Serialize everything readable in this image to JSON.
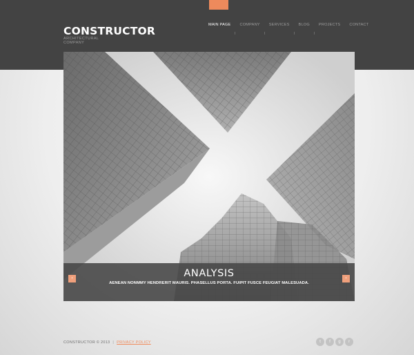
{
  "brand": {
    "name": "CONSTRUCTOR",
    "tagline_line1": "ARCHITECTURAL",
    "tagline_line2": "COMPANY",
    "accent_color": "#ee8a5c"
  },
  "nav": {
    "items": [
      {
        "label": "MAIN PAGE",
        "active": true
      },
      {
        "label": "COMPANY",
        "active": false
      },
      {
        "label": "SERVICES",
        "active": false
      },
      {
        "label": "BLOG",
        "active": false
      },
      {
        "label": "PROJECTS",
        "active": false
      },
      {
        "label": "CONTACT",
        "active": false
      }
    ]
  },
  "slider": {
    "image_alt": "skyscrapers-looking-up",
    "title": "ANALYSIS",
    "text": "AENEAN NONMMY HENDRERIT MAURIS. PHASELLUS PORTA. FUIPIT FUSCE FEUGIAT MALESUADA.",
    "prev_icon": "chevron-left-icon",
    "next_icon": "chevron-right-icon",
    "prev_glyph": "‹",
    "next_glyph": "›"
  },
  "footer": {
    "copyright": "CONSTRUCTOR  © 2013",
    "separator": "|",
    "privacy_label": "PRIVACY POLICY"
  },
  "social": [
    {
      "icon": "twitter-icon",
      "glyph": "t"
    },
    {
      "icon": "facebook-icon",
      "glyph": "f"
    },
    {
      "icon": "google-plus-icon",
      "glyph": "g"
    },
    {
      "icon": "rss-icon",
      "glyph": "r"
    }
  ]
}
